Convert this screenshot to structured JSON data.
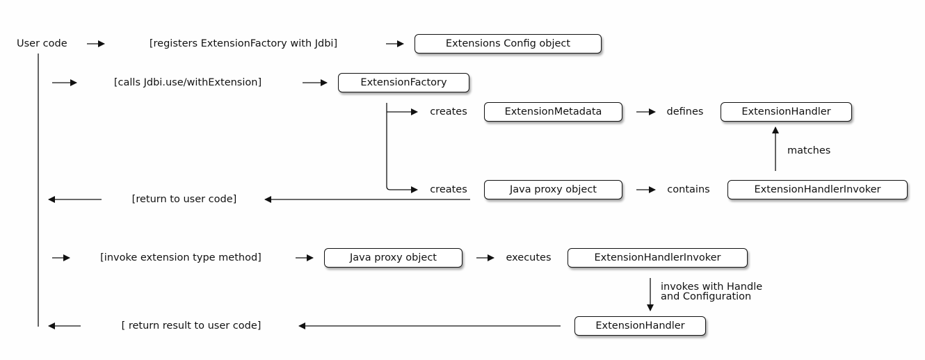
{
  "diagram": {
    "actors": {
      "user_code": "User code"
    },
    "steps": {
      "register": "[registers ExtensionFactory with Jdbi]",
      "calls": "[calls Jdbi.use/withExtension]",
      "return_user": "[return to user code]",
      "invoke_method": "[invoke extension type method]",
      "return_result": "[ return result to user code]"
    },
    "boxes": {
      "extensions_config": "Extensions Config object",
      "extension_factory": "ExtensionFactory",
      "extension_metadata": "ExtensionMetadata",
      "extension_handler_top": "ExtensionHandler",
      "java_proxy_top": "Java proxy object",
      "extension_handler_invoker_top": "ExtensionHandlerInvoker",
      "java_proxy_bottom": "Java proxy object",
      "extension_handler_invoker_bottom": "ExtensionHandlerInvoker",
      "extension_handler_bottom": "ExtensionHandler"
    },
    "edge_labels": {
      "creates_1": "creates",
      "creates_2": "creates",
      "defines": "defines",
      "contains": "contains",
      "matches": "matches",
      "executes": "executes",
      "invokes_line1": "invokes with Handle",
      "invokes_line2": "and Configuration"
    }
  }
}
